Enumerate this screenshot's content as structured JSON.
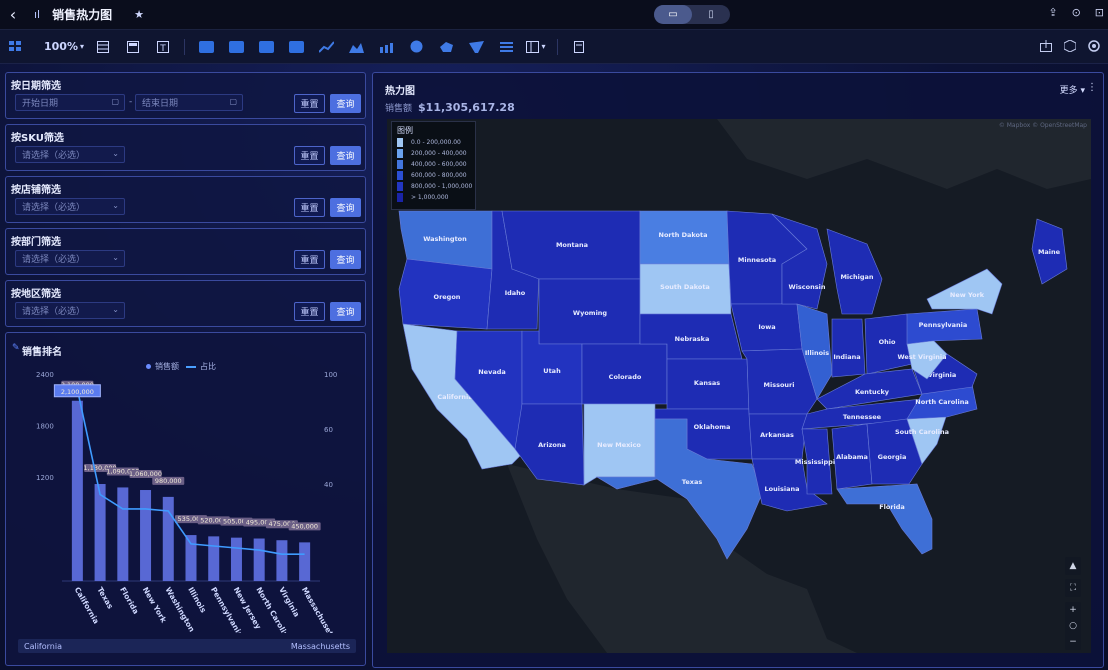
{
  "app": {
    "title": "销售热力图",
    "back_glyph": "‹",
    "title_icon_glyph": "ıl",
    "star_glyph": "★",
    "device_desktop_glyph": "▭",
    "device_mobile_glyph": "▯",
    "top_right_icons": [
      "⇪",
      "⊙",
      "⊡"
    ]
  },
  "toolbar": {
    "zoom": "100%",
    "zoom_caret": "▾",
    "icons": [
      "grid-icon",
      "table-icon",
      "filter-icon",
      "text-icon",
      "bar-chart-icon",
      "column-chart-icon",
      "card-icon",
      "rect-icon",
      "line-chart-icon",
      "area-chart-icon",
      "combo-chart-icon",
      "pie-chart-icon",
      "map-icon",
      "funnel-icon",
      "list-icon",
      "layout-icon",
      "component-icon"
    ],
    "right_icons": [
      "share-icon",
      "cube-icon",
      "settings-icon"
    ]
  },
  "filters": [
    {
      "title": "按日期筛选",
      "type": "date-range",
      "start_placeholder": "开始日期",
      "end_placeholder": "结束日期",
      "sep": "-",
      "reset": "重置",
      "query": "查询"
    },
    {
      "title": "按SKU筛选",
      "type": "select",
      "placeholder": "请选择（必选）",
      "reset": "重置",
      "query": "查询"
    },
    {
      "title": "按店铺筛选",
      "type": "select",
      "placeholder": "请选择（必选）",
      "reset": "重置",
      "query": "查询"
    },
    {
      "title": "按部门筛选",
      "type": "select",
      "placeholder": "请选择（必选）",
      "reset": "重置",
      "query": "查询"
    },
    {
      "title": "按地区筛选",
      "type": "select",
      "placeholder": "请选择（必选）",
      "reset": "重置",
      "query": "查询"
    }
  ],
  "chart_panel": {
    "title": "销售排名",
    "legend": [
      "销售额",
      "占比"
    ],
    "scroll_left": "California",
    "scroll_right": "Massachusetts"
  },
  "chart_data": {
    "type": "bar",
    "title": "销售排名",
    "categories": [
      "California",
      "Texas",
      "Florida",
      "New York",
      "Washington",
      "Illinois",
      "Pennsylvania",
      "New Jersey",
      "North Carolina",
      "Virginia",
      "Massachusetts"
    ],
    "series": [
      {
        "name": "销售额",
        "type": "bar",
        "values": [
          2100,
          1130,
          1090,
          1060,
          980,
          535,
          520,
          505,
          495,
          475,
          450
        ]
      },
      {
        "name": "占比",
        "type": "line",
        "values": [
          0.93,
          0.42,
          0.35,
          0.35,
          0.34,
          0.18,
          0.17,
          0.16,
          0.15,
          0.13,
          0.13
        ]
      }
    ],
    "data_labels": [
      "2,100,000",
      "1,130,000",
      "1,090,000",
      "1,060,000",
      "980,000",
      "535,000",
      "520,000",
      "505,000",
      "495,000",
      "475,000",
      "450,000"
    ],
    "highlight": {
      "index": 0,
      "label": "2,100,000"
    },
    "y_ticks": [
      "2400",
      "1800",
      "1200"
    ],
    "y_right_ticks": [
      "100",
      "60",
      "40"
    ],
    "ylim": [
      0,
      2400
    ]
  },
  "map_panel": {
    "title": "热力图",
    "subtitle_label": "销售额",
    "subtitle_value": "$11,305,617.28",
    "menu": "更多",
    "menu_caret": "▾",
    "kebab": "⋮",
    "credit": "© Mapbox © OpenStreetMap",
    "legend_title": "图例",
    "legend_items": [
      {
        "label": "0.0 - 200,000.00",
        "color": "#9fc6f3"
      },
      {
        "label": "200,000 - 400,000",
        "color": "#6aa2ee"
      },
      {
        "label": "400,000 - 600,000",
        "color": "#4276e0"
      },
      {
        "label": "600,000 - 800,000",
        "color": "#2b4fd3"
      },
      {
        "label": "800,000 - 1,000,000",
        "color": "#2236c2"
      },
      {
        "label": "> 1,000,000",
        "color": "#1a24a8"
      }
    ],
    "controls_top": [
      "▲",
      "⛶"
    ],
    "controls_zoom": [
      "+",
      "○",
      "−"
    ]
  },
  "map_states": [
    {
      "name": "Washington",
      "color": "#3e6fd6"
    },
    {
      "name": "Oregon",
      "color": "#2233c0"
    },
    {
      "name": "California",
      "color": "#9fc6f3"
    },
    {
      "name": "Idaho",
      "color": "#1e2cb4"
    },
    {
      "name": "Nevada",
      "color": "#2233c0"
    },
    {
      "name": "Montana",
      "color": "#1e2cb4"
    },
    {
      "name": "Wyoming",
      "color": "#1e2cb4"
    },
    {
      "name": "Utah",
      "color": "#2233c0"
    },
    {
      "name": "Arizona",
      "color": "#1e2cb4"
    },
    {
      "name": "Colorado",
      "color": "#1e2cb4"
    },
    {
      "name": "New Mexico",
      "color": "#9fc6f3"
    },
    {
      "name": "North Dakota",
      "color": "#4a7ee2"
    },
    {
      "name": "South Dakota",
      "color": "#9fc6f3"
    },
    {
      "name": "Nebraska",
      "color": "#1e2cb4"
    },
    {
      "name": "Kansas",
      "color": "#1e2cb4"
    },
    {
      "name": "Oklahoma",
      "color": "#1e2cb4"
    },
    {
      "name": "Texas",
      "color": "#3e6fd6"
    },
    {
      "name": "Minnesota",
      "color": "#1e2cb4"
    },
    {
      "name": "Iowa",
      "color": "#1e2cb4"
    },
    {
      "name": "Missouri",
      "color": "#1e2cb4"
    },
    {
      "name": "Arkansas",
      "color": "#1e2cb4"
    },
    {
      "name": "Louisiana",
      "color": "#1e2cb4"
    },
    {
      "name": "Wisconsin",
      "color": "#1e2cb4"
    },
    {
      "name": "Illinois",
      "color": "#3360d2"
    },
    {
      "name": "Michigan",
      "color": "#1e2cb4"
    },
    {
      "name": "Indiana",
      "color": "#1e2cb4"
    },
    {
      "name": "Ohio",
      "color": "#1e2cb4"
    },
    {
      "name": "Kentucky",
      "color": "#1e2cb4"
    },
    {
      "name": "Tennessee",
      "color": "#1e2cb4"
    },
    {
      "name": "Mississippi",
      "color": "#1e2cb4"
    },
    {
      "name": "Alabama",
      "color": "#1e2cb4"
    },
    {
      "name": "Georgia",
      "color": "#1e2cb4"
    },
    {
      "name": "Florida",
      "color": "#3e6fd6"
    },
    {
      "name": "South Carolina",
      "color": "#9fc6f3"
    },
    {
      "name": "North Carolina",
      "color": "#2d4bd0"
    },
    {
      "name": "Virginia",
      "color": "#1e2cb4"
    },
    {
      "name": "West Virginia",
      "color": "#9fc6f3"
    },
    {
      "name": "Pennsylvania",
      "color": "#2d4bd0"
    },
    {
      "name": "New York",
      "color": "#9fc6f3"
    },
    {
      "name": "Maine",
      "color": "#1e2cb4"
    }
  ]
}
